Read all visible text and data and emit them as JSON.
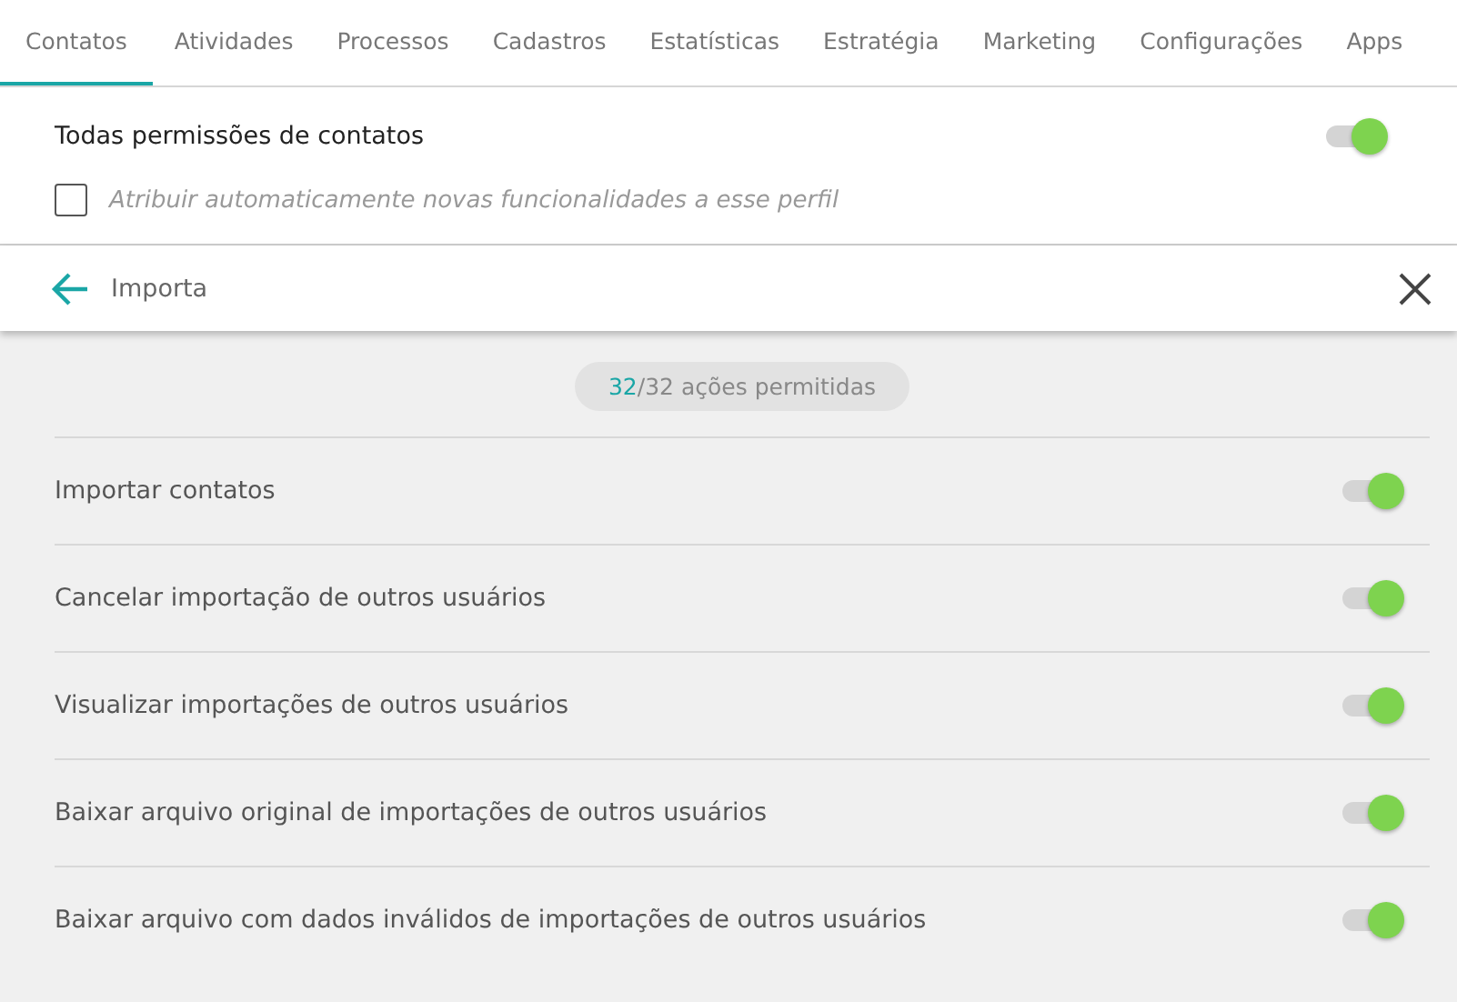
{
  "tabs": [
    {
      "label": "Contatos",
      "selected": true
    },
    {
      "label": "Atividades",
      "selected": false
    },
    {
      "label": "Processos",
      "selected": false
    },
    {
      "label": "Cadastros",
      "selected": false
    },
    {
      "label": "Estatísticas",
      "selected": false
    },
    {
      "label": "Estratégia",
      "selected": false
    },
    {
      "label": "Marketing",
      "selected": false
    },
    {
      "label": "Configurações",
      "selected": false
    },
    {
      "label": "Apps",
      "selected": false
    }
  ],
  "all_permissions": {
    "label": "Todas permissões de contatos",
    "on": true
  },
  "auto_assign": {
    "label": "Atribuir automaticamente novas funcionalidades a esse perfil",
    "checked": false
  },
  "header": {
    "title": "Importa"
  },
  "counter": {
    "allowed": "32",
    "rest": "/32 ações permitidas"
  },
  "permissions": [
    {
      "label": "Importar contatos",
      "on": true
    },
    {
      "label": "Cancelar importação de outros usuários",
      "on": true
    },
    {
      "label": "Visualizar importações de outros usuários",
      "on": true
    },
    {
      "label": "Baixar arquivo original de importações de outros usuários",
      "on": true
    },
    {
      "label": "Baixar arquivo com dados inválidos de importações de outros usuários",
      "on": true
    }
  ]
}
